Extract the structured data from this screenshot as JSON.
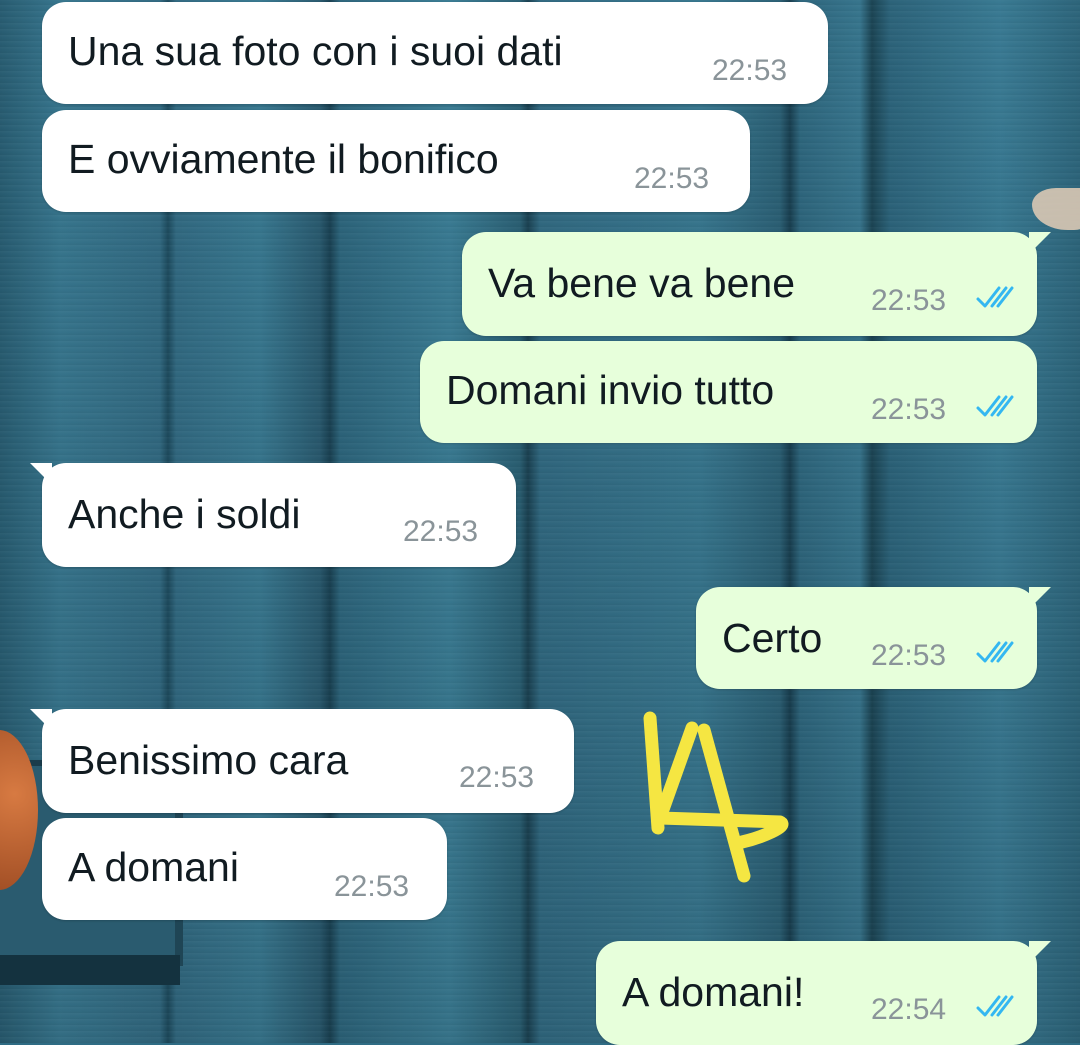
{
  "colors": {
    "incoming_bubble": "#ffffff",
    "outgoing_bubble": "#e7ffdb",
    "read_ticks": "#34b7f1",
    "annotation": "#f5e642"
  },
  "messages": [
    {
      "direction": "incoming",
      "text": "Una sua foto con i suoi dati",
      "time": "22:53"
    },
    {
      "direction": "incoming",
      "text": "E ovviamente il bonifico",
      "time": "22:53"
    },
    {
      "direction": "outgoing",
      "text": "Va bene va bene",
      "time": "22:53",
      "status": "read"
    },
    {
      "direction": "outgoing",
      "text": "Domani invio tutto",
      "time": "22:53",
      "status": "read"
    },
    {
      "direction": "incoming",
      "text": "Anche i soldi",
      "time": "22:53"
    },
    {
      "direction": "outgoing",
      "text": "Certo",
      "time": "22:53",
      "status": "read"
    },
    {
      "direction": "incoming",
      "text": "Benissimo cara",
      "time": "22:53"
    },
    {
      "direction": "incoming",
      "text": "A domani",
      "time": "22:53"
    },
    {
      "direction": "outgoing",
      "text": "A domani!",
      "time": "22:54",
      "status": "read"
    }
  ],
  "annotation": {
    "text": "14",
    "style": "handwritten-marker"
  },
  "icons": {
    "read_status": "double-check-icon"
  }
}
